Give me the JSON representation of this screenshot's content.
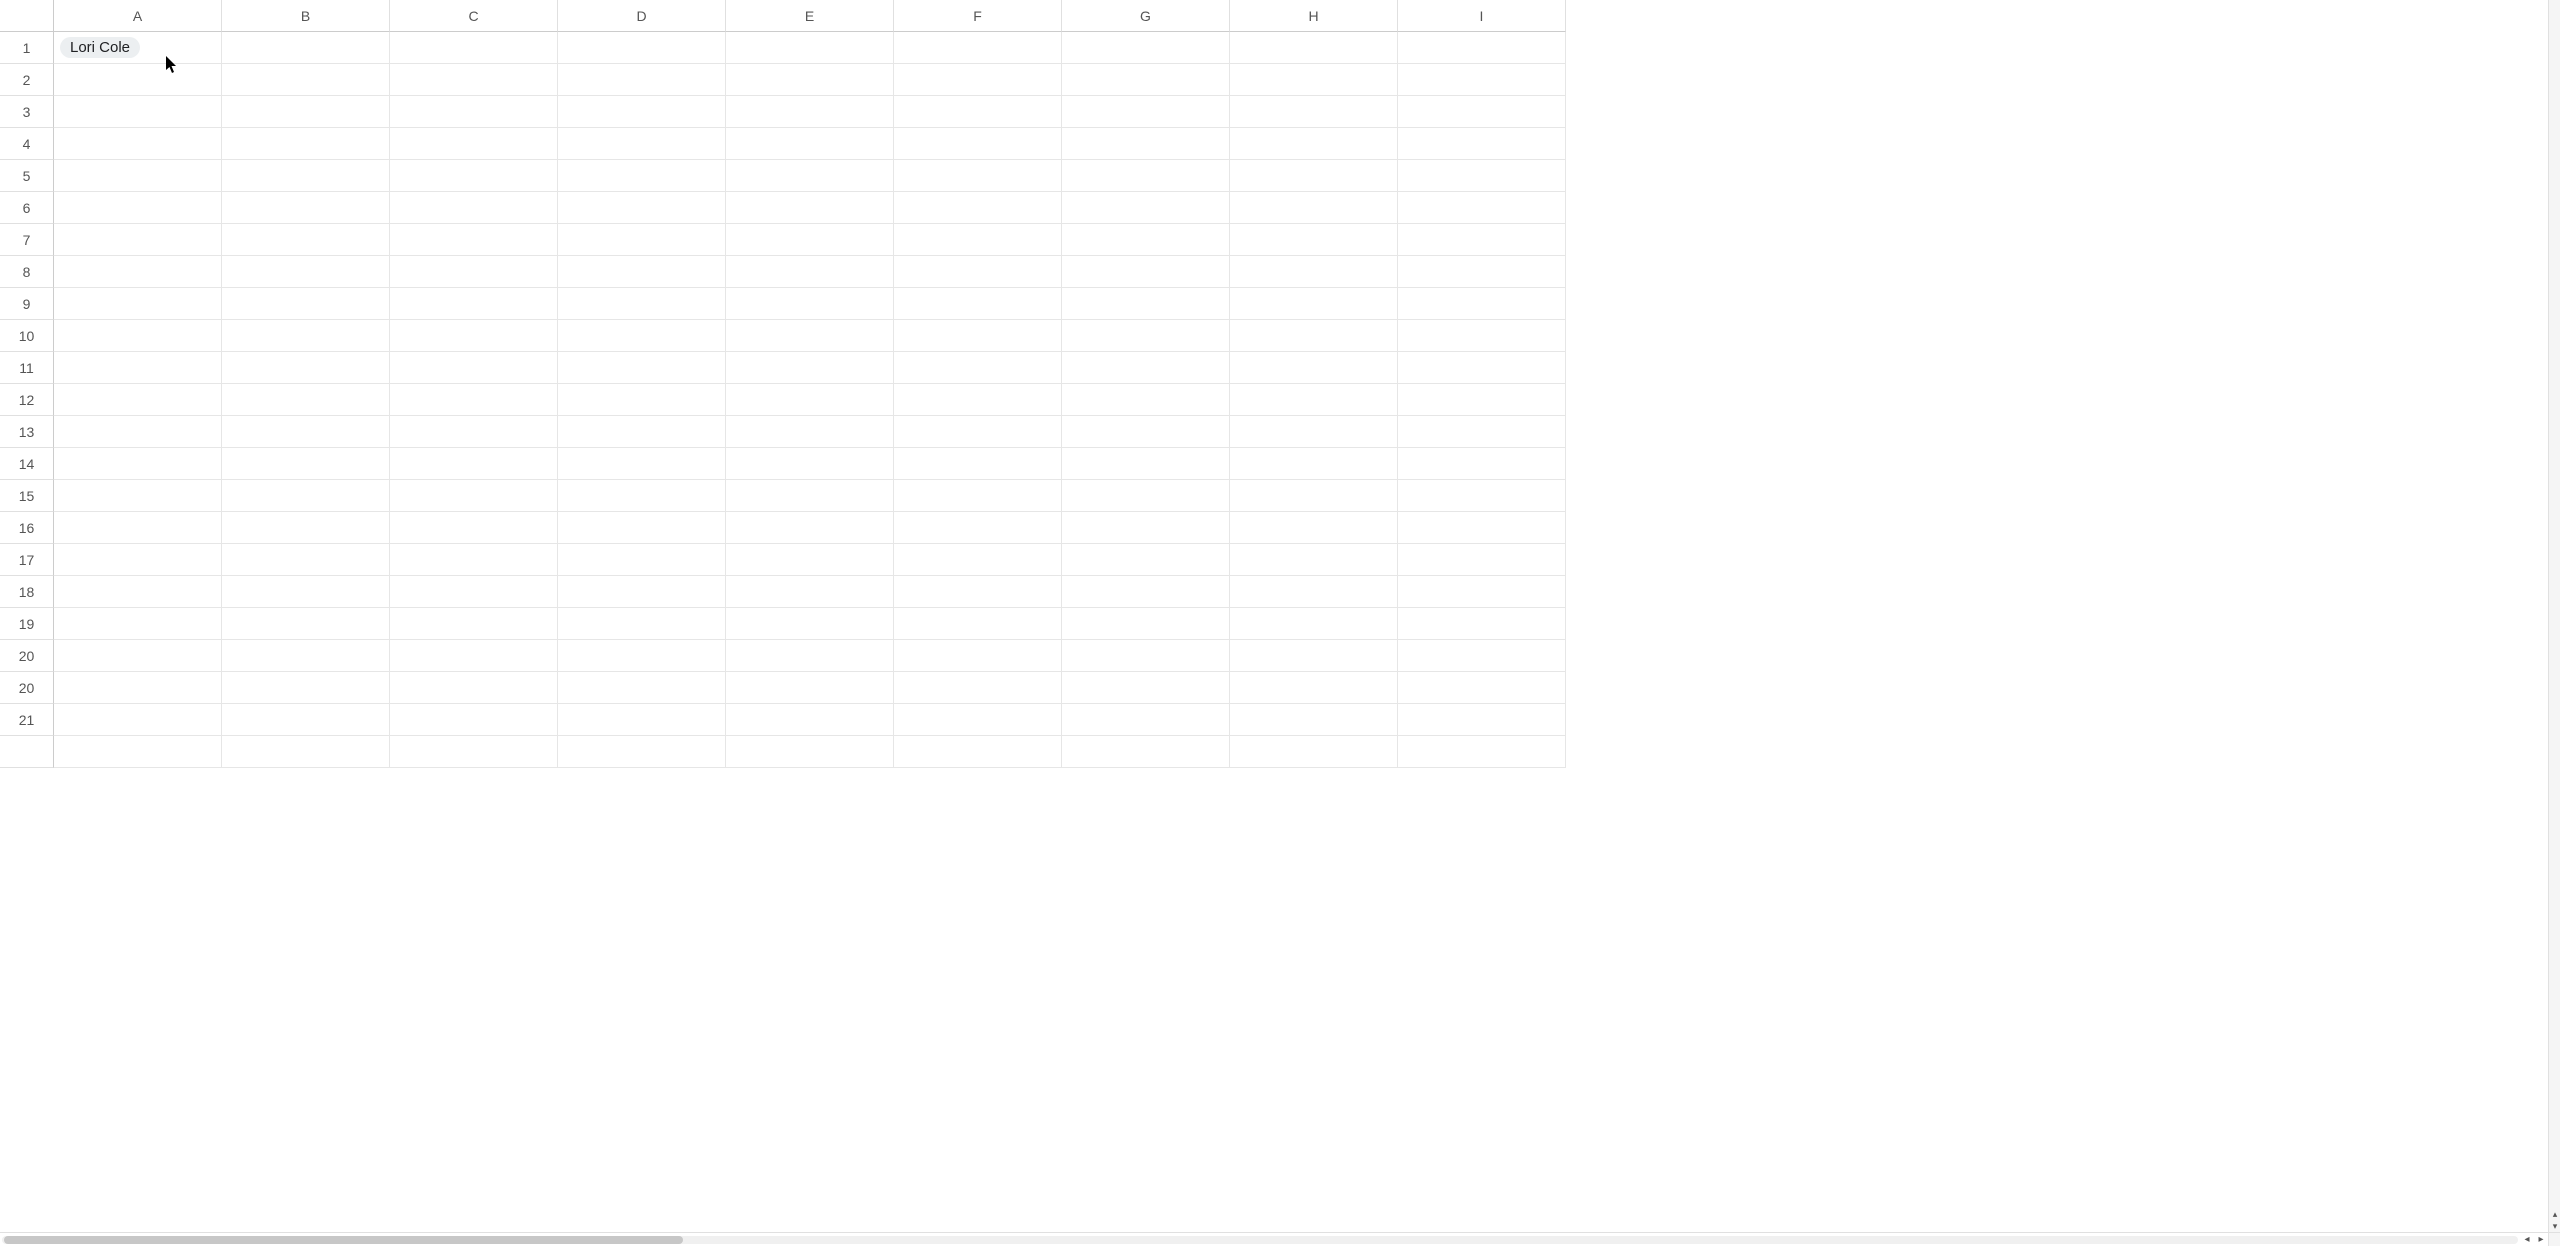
{
  "columns": [
    "A",
    "B",
    "C",
    "D",
    "E",
    "F",
    "G",
    "H",
    "I"
  ],
  "rows": [
    "1",
    "2",
    "3",
    "4",
    "5",
    "6",
    "7",
    "8",
    "9",
    "10",
    "11",
    "12",
    "13",
    "14",
    "15",
    "16",
    "17",
    "18",
    "19",
    "20",
    "20",
    "21",
    ""
  ],
  "cells": {
    "A1": {
      "chip": true,
      "value": "Lori Cole"
    }
  },
  "hscroll": {
    "left_arrow": "◂",
    "right_arrow": "▸"
  },
  "vscroll": {
    "up_arrow": "▴",
    "down_arrow": "▾"
  }
}
